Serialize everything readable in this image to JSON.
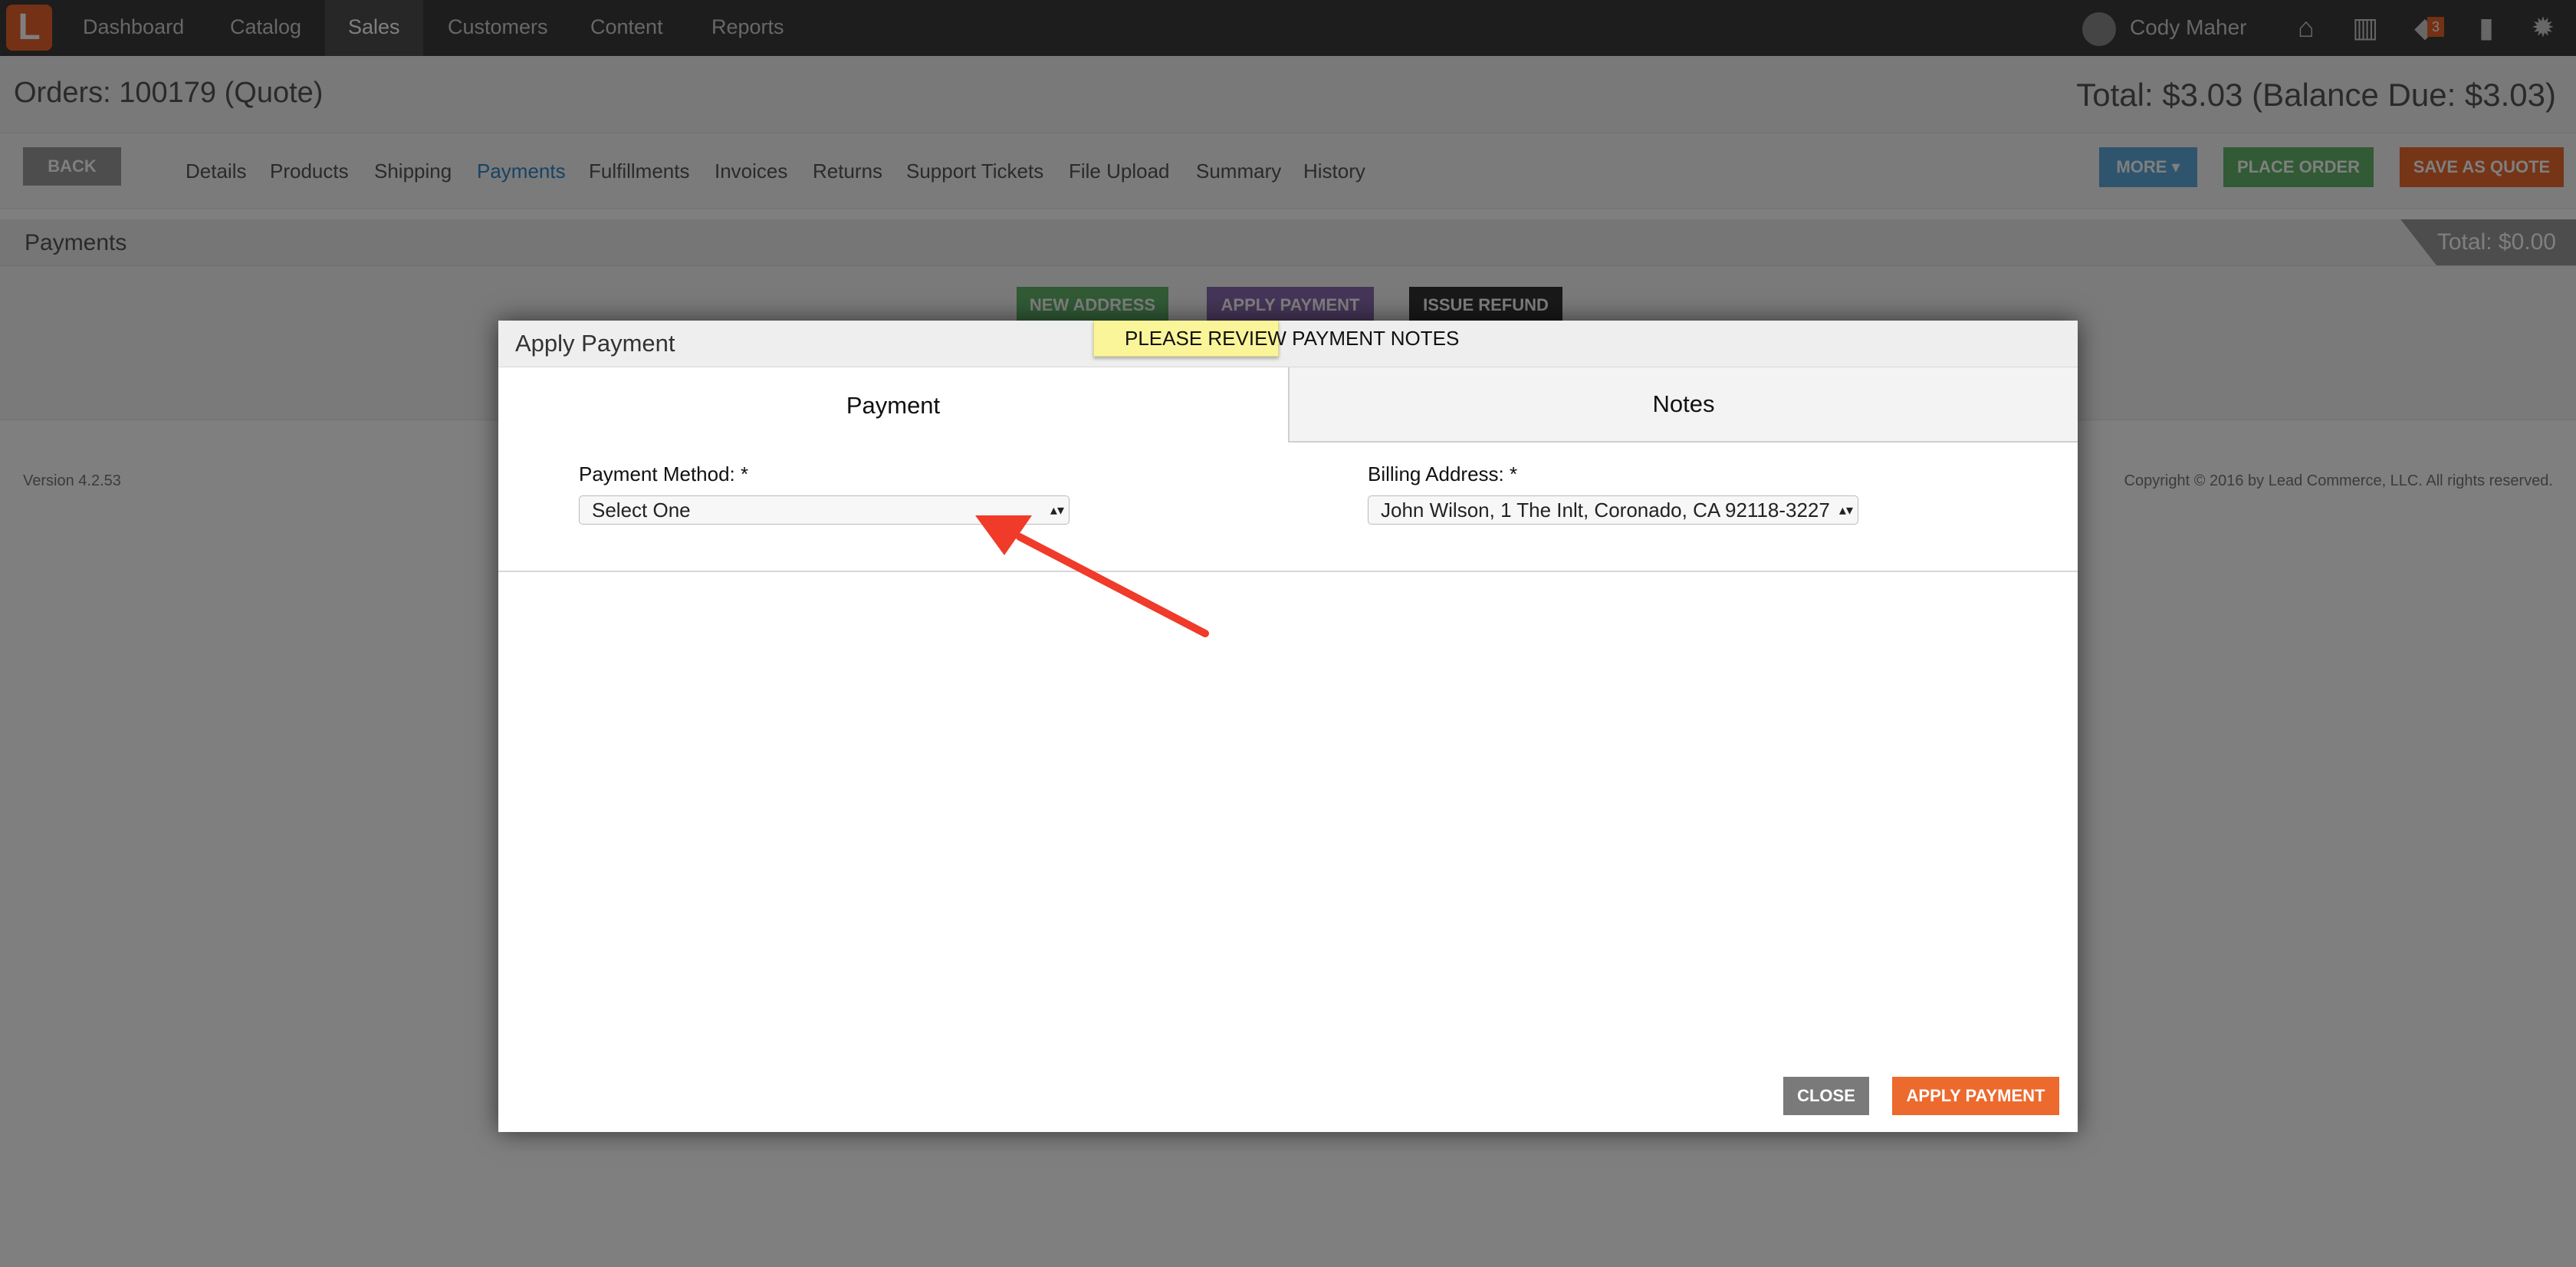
{
  "nav": {
    "items": [
      "Dashboard",
      "Catalog",
      "Sales",
      "Customers",
      "Content",
      "Reports"
    ],
    "active": "Sales",
    "user_name": "Cody Maher",
    "badge_count": "3"
  },
  "order": {
    "title": "Orders: 100179 (Quote)",
    "total": "Total: $3.03 (Balance Due: $3.03)"
  },
  "subnav": {
    "back_label": "BACK",
    "tabs": [
      "Details",
      "Products",
      "Shipping",
      "Payments",
      "Fulfillments",
      "Invoices",
      "Returns",
      "Support Tickets",
      "File Upload",
      "Summary",
      "History"
    ],
    "active_tab": "Payments",
    "more_label": "MORE ▾",
    "place_order_label": "PLACE ORDER",
    "save_quote_label": "SAVE AS QUOTE"
  },
  "payments_section": {
    "title": "Payments",
    "total": "Total: $0.00",
    "new_address_label": "NEW ADDRESS",
    "apply_payment_label": "APPLY PAYMENT",
    "issue_refund_label": "ISSUE REFUND"
  },
  "footer": {
    "version": "Version 4.2.53",
    "copyright": "Copyright © 2016 by Lead Commerce, LLC. All rights reserved."
  },
  "modal": {
    "title": "Apply Payment",
    "notice": "PLEASE REVIEW PAYMENT NOTES",
    "tab_payment": "Payment",
    "tab_notes": "Notes",
    "payment_method_label": "Payment Method: *",
    "payment_method_value": "Select One",
    "billing_address_label": "Billing Address: *",
    "billing_address_value": "John Wilson, 1 The Inlt, Coronado, CA 92118-3227",
    "close_label": "CLOSE",
    "apply_label": "APPLY PAYMENT"
  },
  "colors": {
    "accent_orange": "#ec6a2e",
    "notice_yellow": "#fbf59a",
    "annotation_red": "#f03a2a"
  }
}
